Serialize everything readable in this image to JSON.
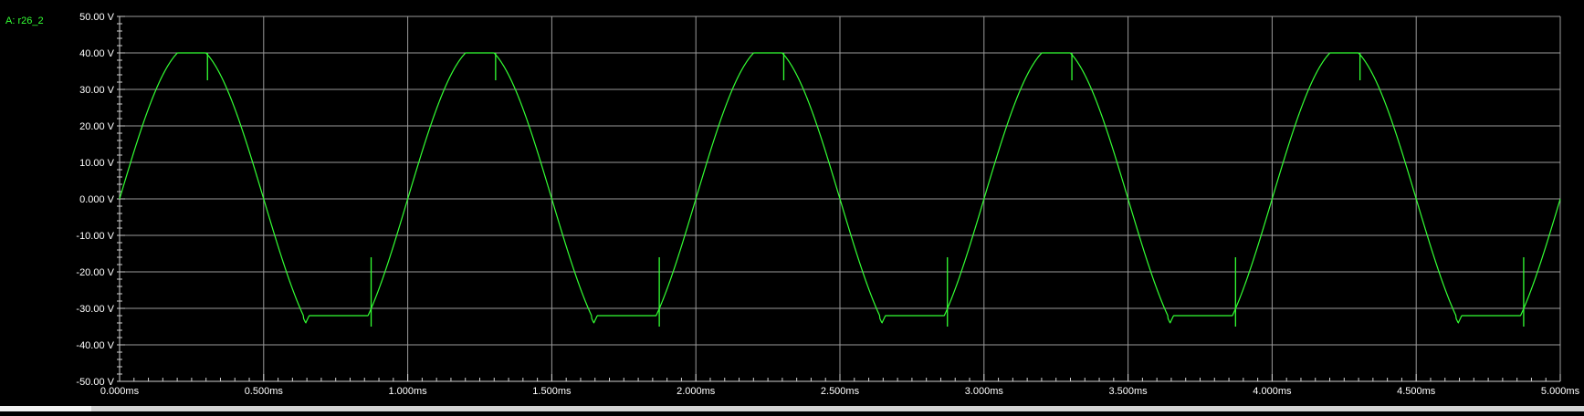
{
  "colors": {
    "background": "#000000",
    "grid": "#9a9a9a",
    "axis": "#cfcfcf",
    "text": "#ffffff",
    "trace": "#33ff33",
    "channel_label": "#33ff33"
  },
  "channel_label": "A: r26_2",
  "chart_data": {
    "type": "line",
    "title": "",
    "xlabel": "",
    "ylabel": "",
    "grid": true,
    "legend": "top-left",
    "xlim": [
      0,
      5.0
    ],
    "ylim": [
      -50,
      50
    ],
    "x_unit": "ms",
    "y_unit": "V",
    "x_ticks": [
      {
        "value": 0.0,
        "label": "0.000ms"
      },
      {
        "value": 0.5,
        "label": "0.500ms"
      },
      {
        "value": 1.0,
        "label": "1.000ms"
      },
      {
        "value": 1.5,
        "label": "1.500ms"
      },
      {
        "value": 2.0,
        "label": "2.000ms"
      },
      {
        "value": 2.5,
        "label": "2.500ms"
      },
      {
        "value": 3.0,
        "label": "3.000ms"
      },
      {
        "value": 3.5,
        "label": "3.500ms"
      },
      {
        "value": 4.0,
        "label": "4.000ms"
      },
      {
        "value": 4.5,
        "label": "4.500ms"
      },
      {
        "value": 5.0,
        "label": "5.000ms"
      }
    ],
    "y_ticks": [
      {
        "value": 50,
        "label": "50.00 V"
      },
      {
        "value": 40,
        "label": "40.00 V"
      },
      {
        "value": 30,
        "label": "30.00 V"
      },
      {
        "value": 20,
        "label": "20.00 V"
      },
      {
        "value": 10,
        "label": "10.00 V"
      },
      {
        "value": 0,
        "label": "0.000 V"
      },
      {
        "value": -10,
        "label": "-10.00 V"
      },
      {
        "value": -20,
        "label": "-20.00 V"
      },
      {
        "value": -30,
        "label": "-30.00 V"
      },
      {
        "value": -40,
        "label": "-40.00 V"
      },
      {
        "value": -50,
        "label": "-50.00 V"
      }
    ],
    "minor_x_step": 0.05,
    "minor_y_step": 2,
    "series": [
      {
        "name": "A: r26_2",
        "color": "#33ff33",
        "waveform": {
          "shape": "clipped-sine",
          "period": 1.0,
          "amplitude": 42,
          "positive_clip": 40,
          "negative_clip": -32,
          "negative_overshoot": -34,
          "positive_spike_time": 0.305,
          "positive_spike_min": 32.5,
          "negative_spike_time": 0.873,
          "negative_spike_max": -16,
          "negative_spike_min": -35,
          "cycles": 5
        }
      }
    ]
  }
}
